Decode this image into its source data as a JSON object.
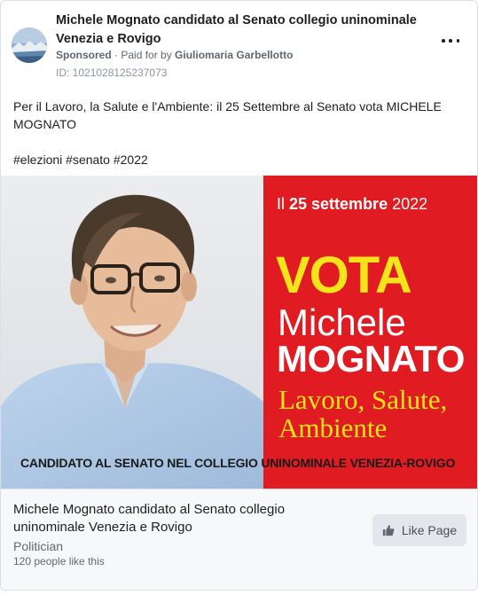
{
  "header": {
    "page_name": "Michele Mognato candidato al Senato collegio uninominale Venezia e Rovigo",
    "sponsored": "Sponsored",
    "separator": " · ",
    "paid_for_prefix": "Paid for by ",
    "payer": "Giuliomaria Garbellotto",
    "ad_id": "ID: 1021028125237073",
    "more_icon": "more-options-icon"
  },
  "post": {
    "text": "Per il Lavoro, la Salute e l'Ambiente: il 25 Settembre al Senato vota MICHELE MOGNATO",
    "hashtags": "#elezioni #senato #2022"
  },
  "creative": {
    "date_prefix": "Il ",
    "date_bold": "25 settembre",
    "date_year": " 2022",
    "vota": "VOTA",
    "first_name": "Michele",
    "last_name": "MOGNATO",
    "slogan_line1": "Lavoro, Salute,",
    "slogan_line2": "Ambiente",
    "banner": "CANDIDATO AL SENATO NEL COLLEGIO UNINOMINALE  VENEZIA-ROVIGO",
    "colors": {
      "red_panel": "#e01b22",
      "accent_yellow": "#f4e51a"
    }
  },
  "footer": {
    "title": "Michele Mognato candidato al Senato collegio uninominale Venezia e Rovigo",
    "category": "Politician",
    "likes": "120 people like this",
    "like_button": "Like Page",
    "like_icon": "thumbs-up-icon"
  }
}
